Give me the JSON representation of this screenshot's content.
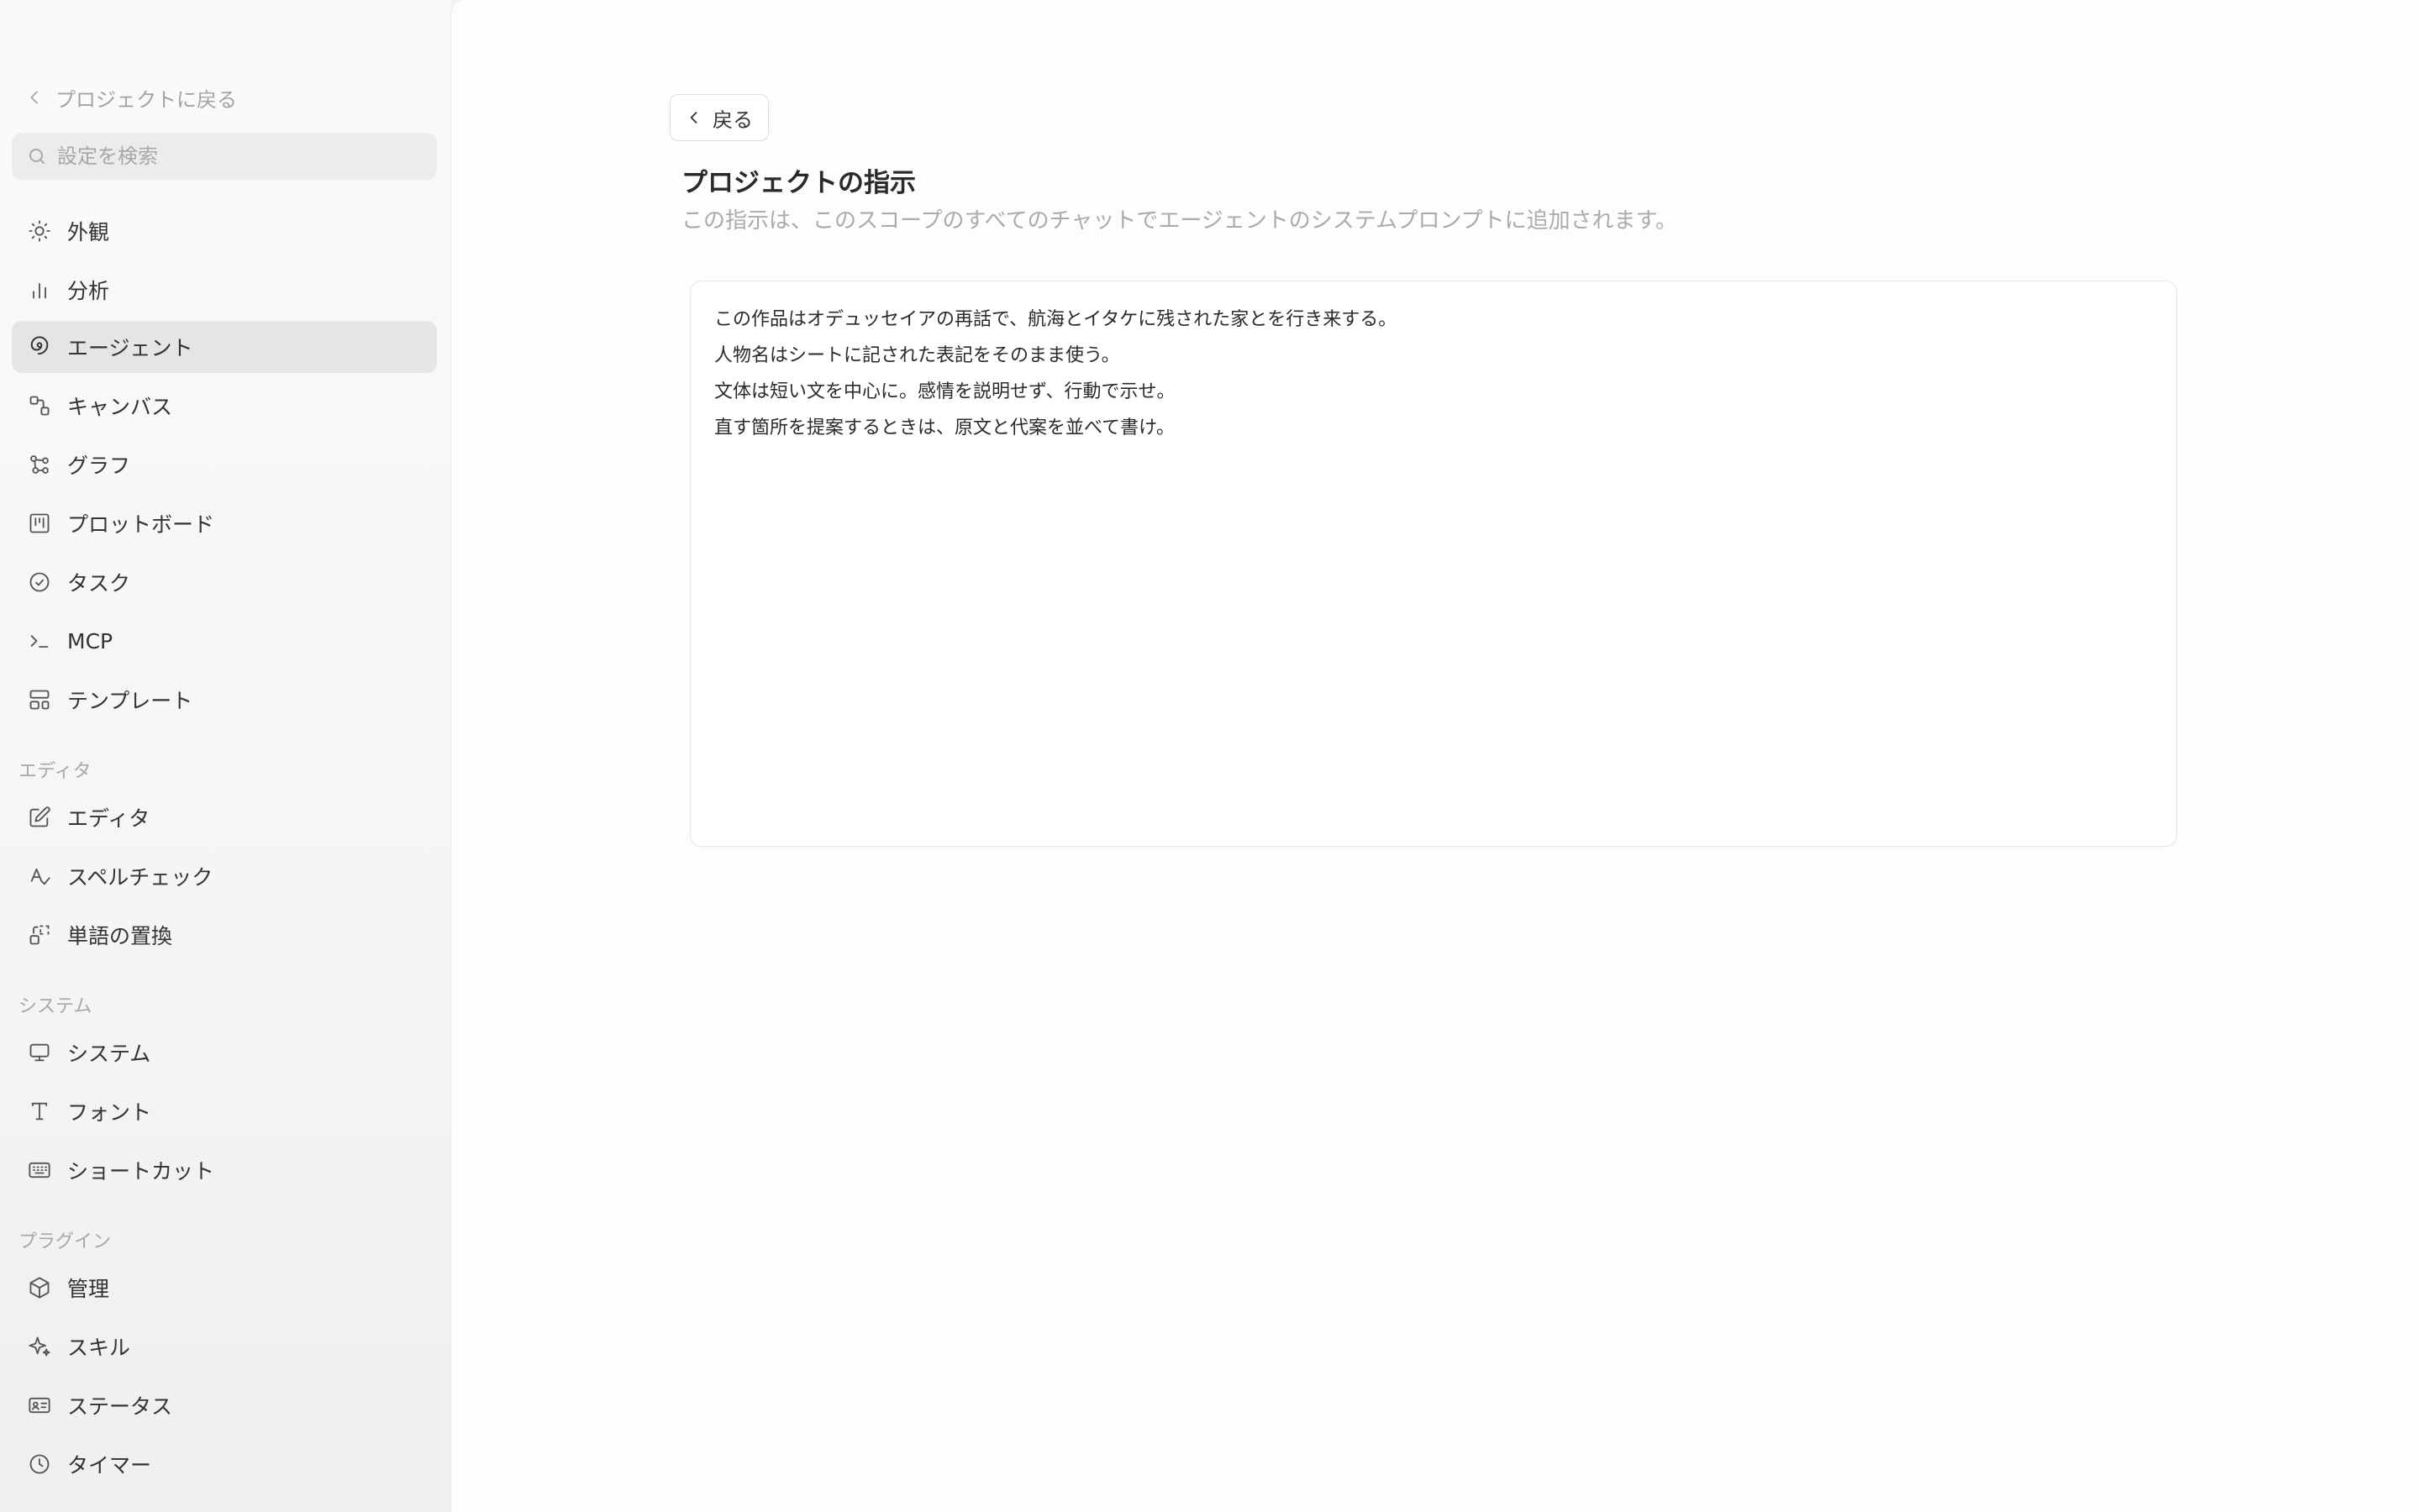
{
  "sidebar": {
    "back_label": "プロジェクトに戻る",
    "search": {
      "placeholder": "設定を検索",
      "value": ""
    },
    "items": [
      {
        "label": "外観",
        "icon": "sun-icon"
      },
      {
        "label": "分析",
        "icon": "bar-chart-icon"
      },
      {
        "label": "エージェント",
        "icon": "swirl-icon",
        "active": true
      },
      {
        "label": "キャンバス",
        "icon": "canvas-icon"
      },
      {
        "label": "グラフ",
        "icon": "graph-icon"
      },
      {
        "label": "プロットボード",
        "icon": "kanban-icon"
      },
      {
        "label": "タスク",
        "icon": "check-circle-icon"
      },
      {
        "label": "MCP",
        "icon": "terminal-icon"
      },
      {
        "label": "テンプレート",
        "icon": "template-icon"
      }
    ],
    "sections": [
      {
        "label": "エディタ",
        "items": [
          {
            "label": "エディタ",
            "icon": "edit-icon"
          },
          {
            "label": "スペルチェック",
            "icon": "spellcheck-icon"
          },
          {
            "label": "単語の置換",
            "icon": "replace-icon"
          }
        ]
      },
      {
        "label": "システム",
        "items": [
          {
            "label": "システム",
            "icon": "monitor-icon"
          },
          {
            "label": "フォント",
            "icon": "type-icon"
          },
          {
            "label": "ショートカット",
            "icon": "keyboard-icon"
          }
        ]
      },
      {
        "label": "プラグイン",
        "items": [
          {
            "label": "管理",
            "icon": "package-icon"
          },
          {
            "label": "スキル",
            "icon": "sparkle-icon"
          },
          {
            "label": "ステータス",
            "icon": "id-card-icon"
          },
          {
            "label": "タイマー",
            "icon": "clock-icon"
          }
        ]
      }
    ]
  },
  "main": {
    "back_button_label": "戻る",
    "title": "プロジェクトの指示",
    "subtitle": "この指示は、このスコープのすべてのチャットでエージェントのシステムプロンプトに追加されます。",
    "instructions_text": "この作品はオデュッセイアの再話で、航海とイタケに残された家とを行き来する。\n人物名はシートに記された表記をそのまま使う。\n文体は短い文を中心に。感情を説明せず、行動で示せ。\n直す箇所を提案するときは、原文と代案を並べて書け。"
  },
  "colors": {
    "sidebar_bg": "#f7f7f7",
    "active_item_bg": "#e5e5e5",
    "main_bg": "#fdfdfd",
    "muted_text": "#a8a8a8",
    "text": "#2b2b2b"
  }
}
